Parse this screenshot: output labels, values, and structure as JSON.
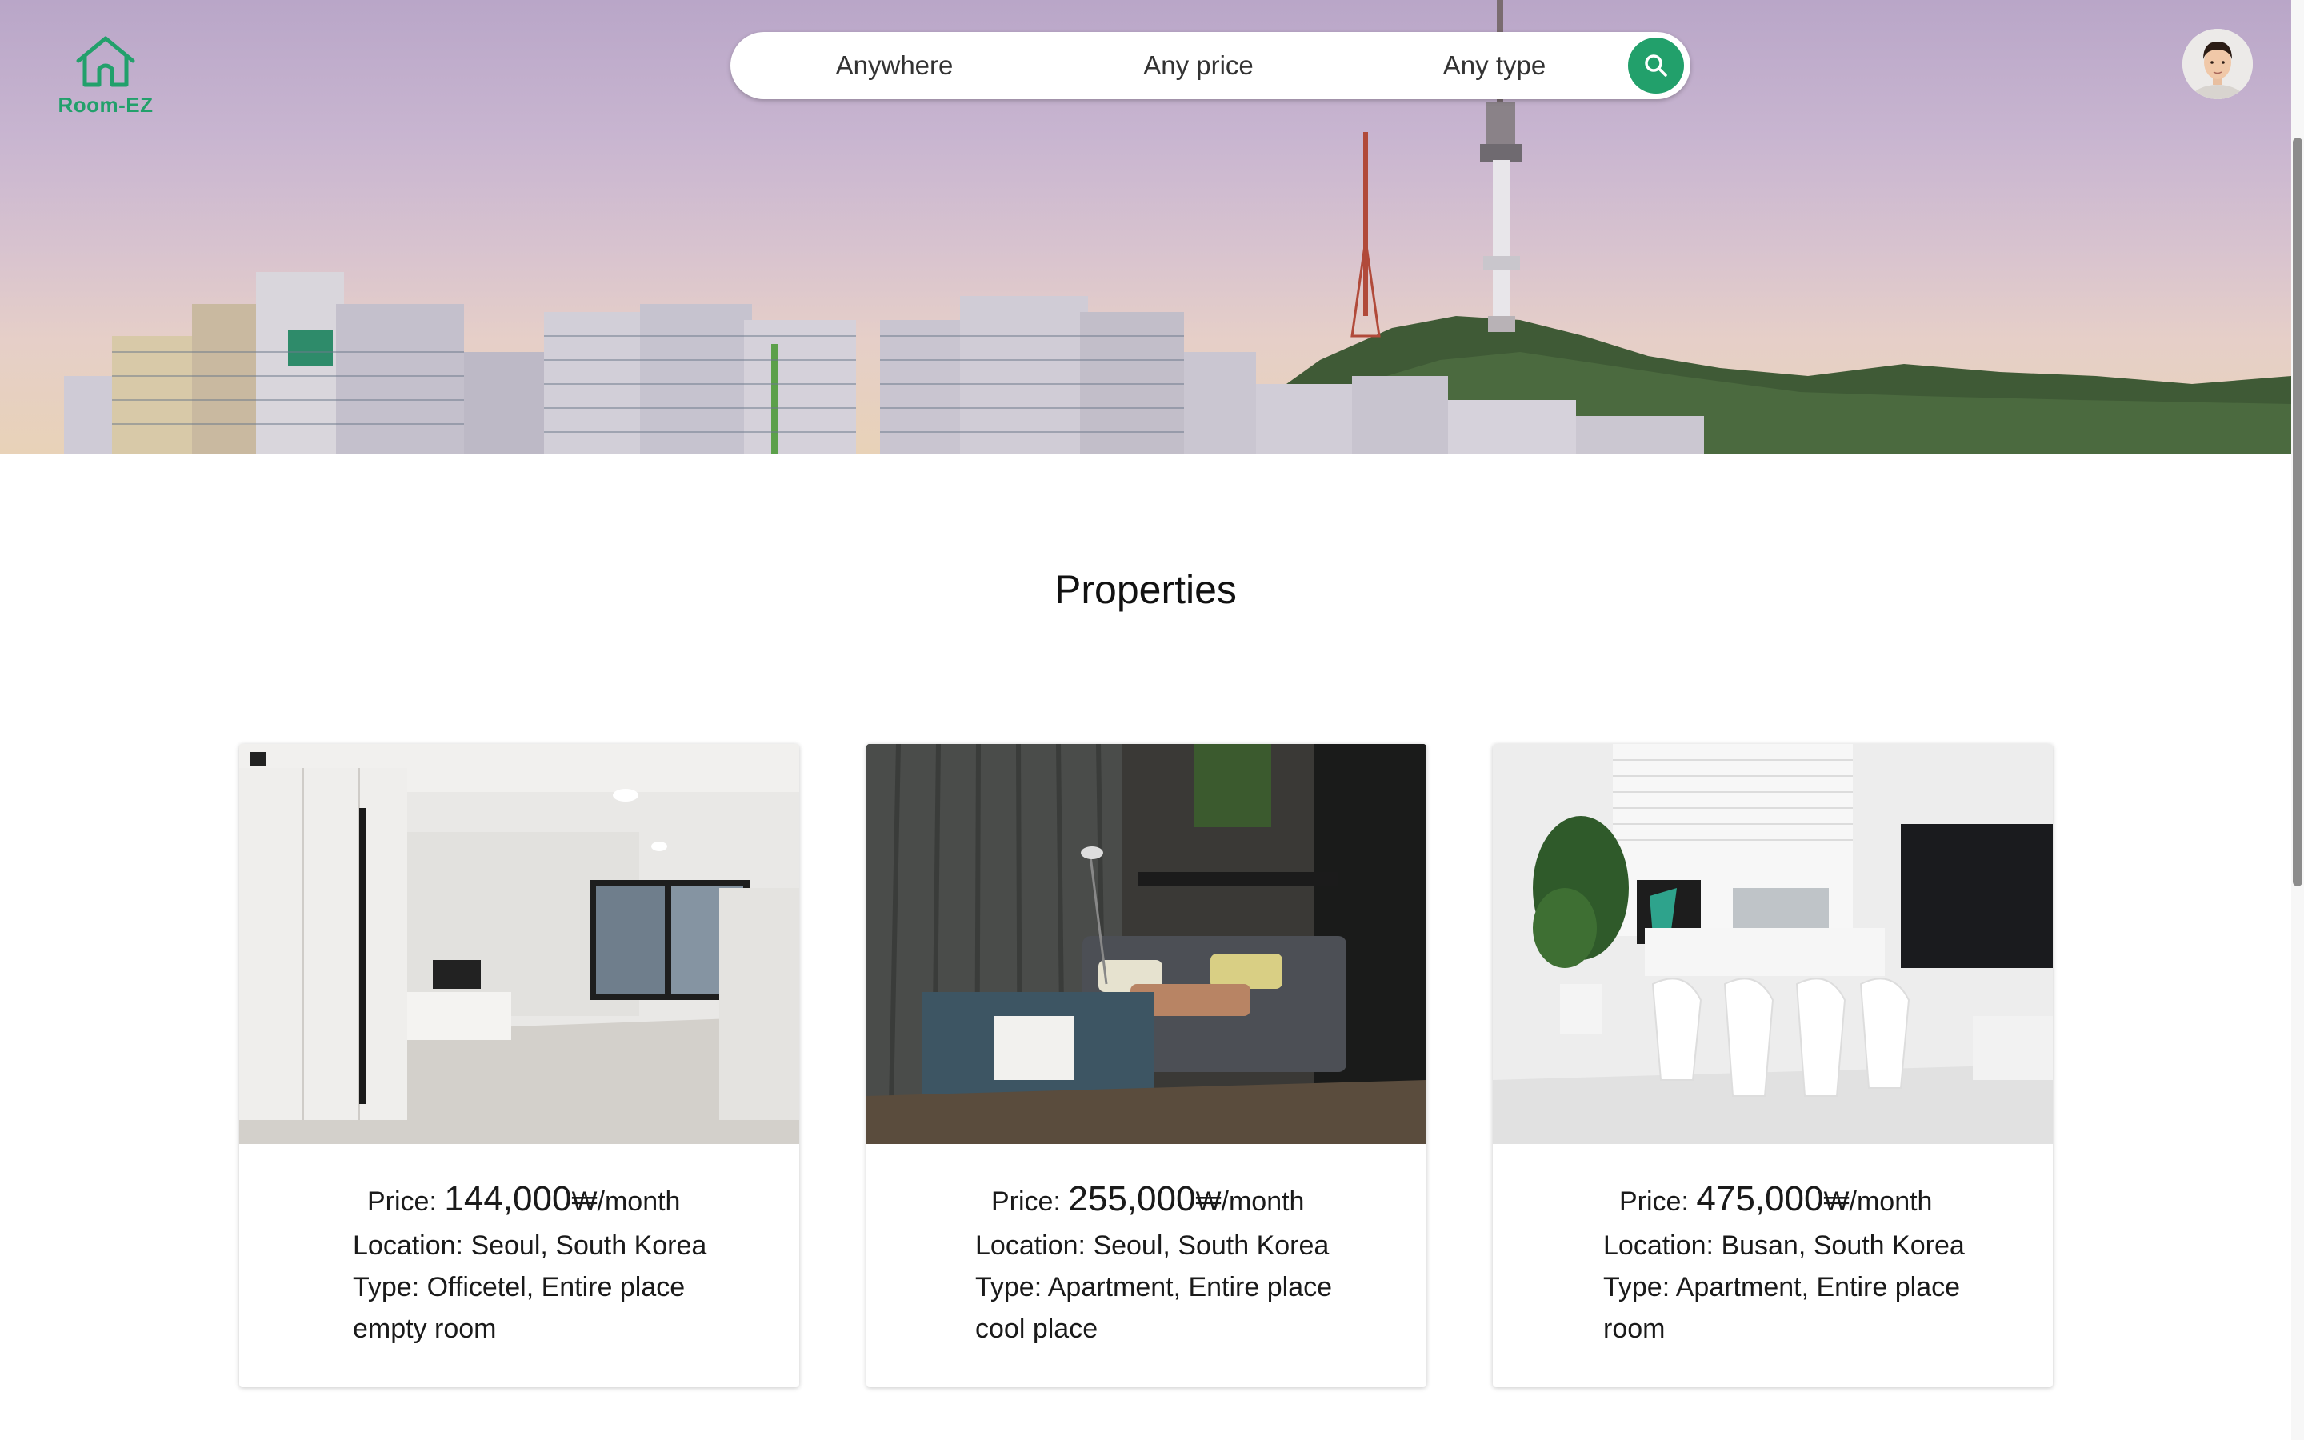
{
  "brand": {
    "name": "Room-EZ",
    "color": "#22a06b"
  },
  "search": {
    "location": "Anywhere",
    "price": "Any price",
    "type": "Any type",
    "button_icon": "search-icon"
  },
  "user": {
    "avatar_icon": "user-avatar"
  },
  "section": {
    "title": "Properties"
  },
  "price_label": "Price:",
  "price_unit": "₩/month",
  "properties": [
    {
      "price": "144,000",
      "location": "Location: Seoul, South Korea",
      "type": "Type: Officetel, Entire place",
      "description": "empty room",
      "photo": "empty white room with window"
    },
    {
      "price": "255,000",
      "location": "Location: Seoul, South Korea",
      "type": "Type: Apartment, Entire place",
      "description": "cool place",
      "photo": "dark living room with sofa"
    },
    {
      "price": "475,000",
      "location": "Location: Busan, South Korea",
      "type": "Type: Apartment, Entire place",
      "description": "room",
      "photo": "white dining room with table"
    }
  ]
}
